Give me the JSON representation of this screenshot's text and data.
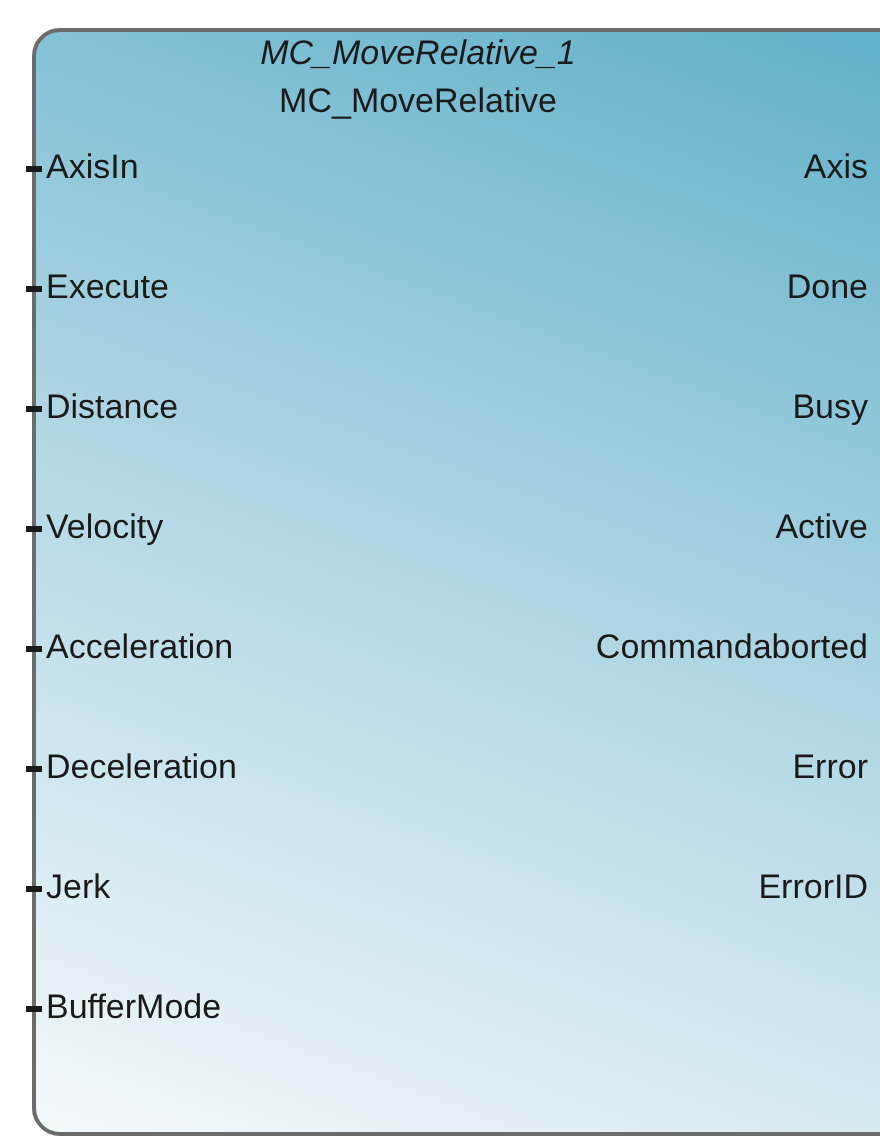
{
  "block": {
    "instance_name": "MC_MoveRelative_1",
    "type_name": "MC_MoveRelative",
    "inputs": [
      "AxisIn",
      "Execute",
      "Distance",
      "Velocity",
      "Acceleration",
      "Deceleration",
      "Jerk",
      "BufferMode"
    ],
    "outputs": [
      "Axis",
      "Done",
      "Busy",
      "Active",
      "Commandaborted",
      "Error",
      "ErrorID"
    ]
  }
}
